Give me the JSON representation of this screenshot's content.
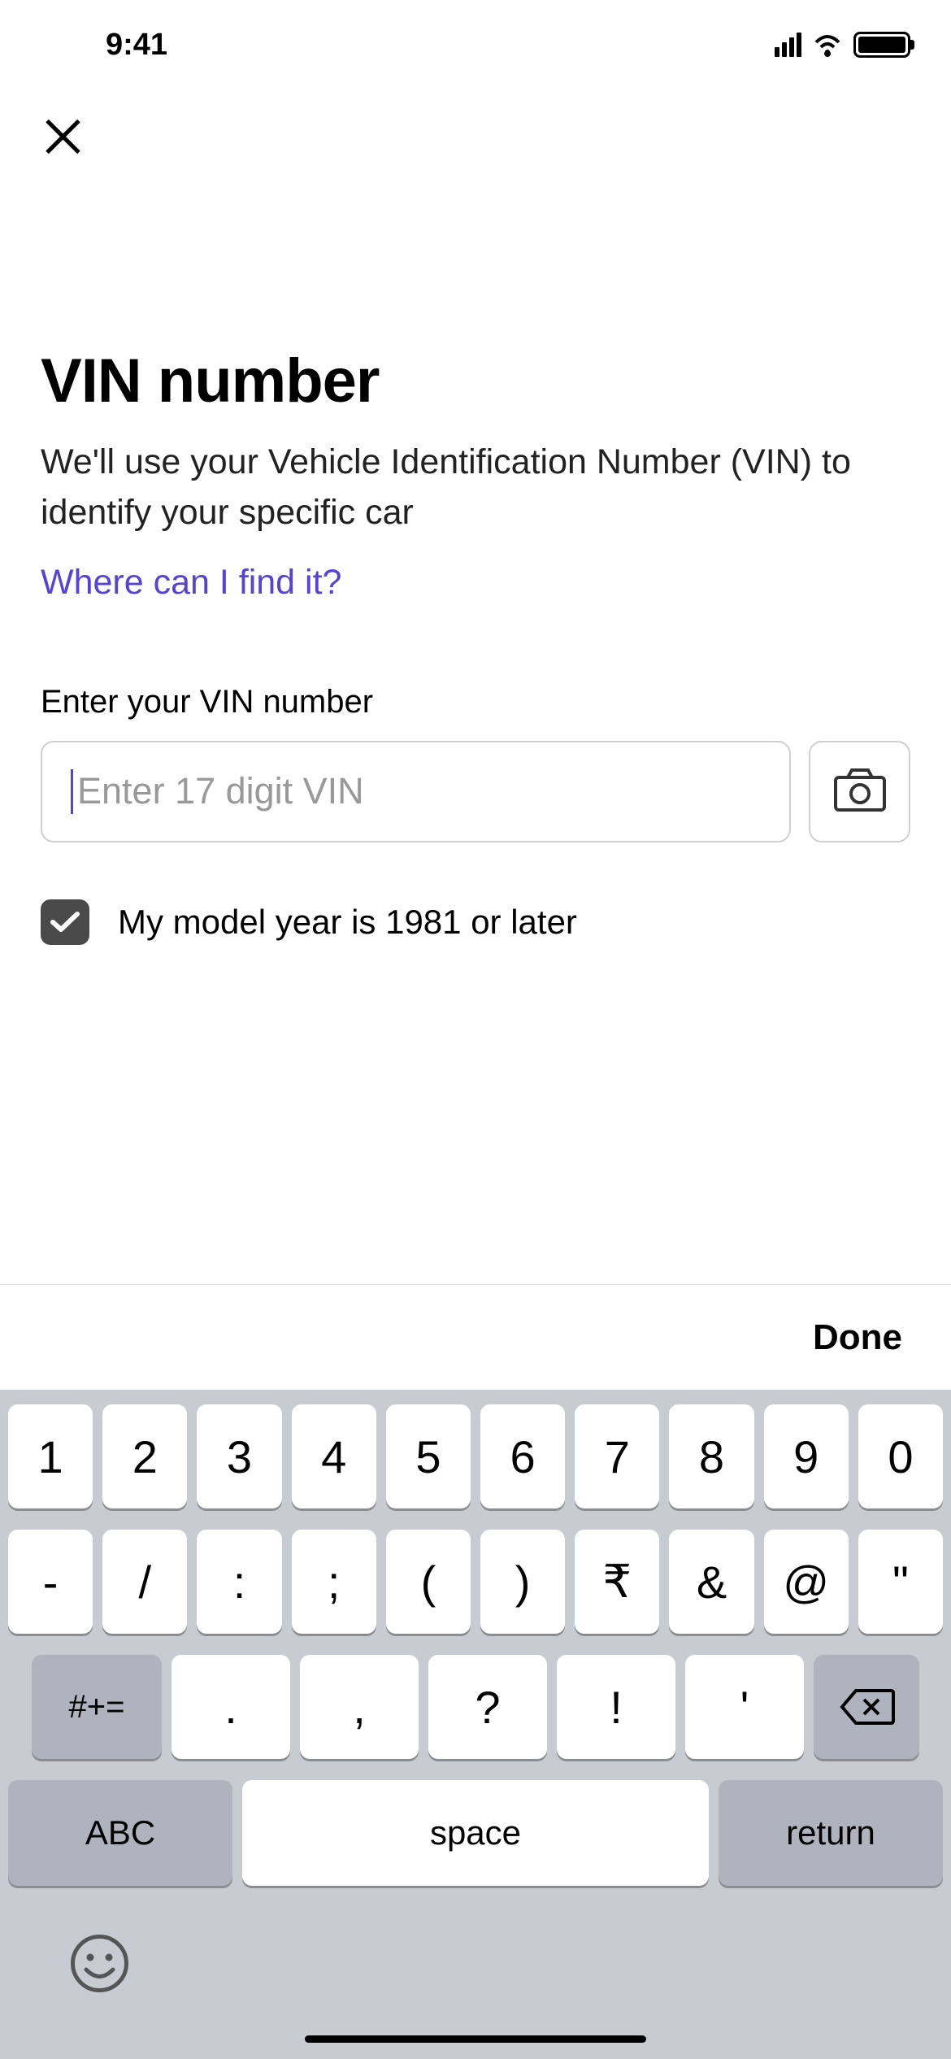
{
  "status_bar": {
    "time": "9:41"
  },
  "page": {
    "title": "VIN number",
    "description": "We'll use your Vehicle Identification Number (VIN) to identify your specific car",
    "help_link": "Where can I find it?",
    "field_label": "Enter your VIN number",
    "input_placeholder": "Enter 17 digit VIN",
    "checkbox_label": "My model year is 1981 or later",
    "checkbox_checked": true
  },
  "keyboard": {
    "toolbar_done": "Done",
    "row1": [
      "1",
      "2",
      "3",
      "4",
      "5",
      "6",
      "7",
      "8",
      "9",
      "0"
    ],
    "row2": [
      "-",
      "/",
      ":",
      ";",
      "(",
      ")",
      "₹",
      "&",
      "@",
      "\""
    ],
    "row3_symbols": "#+=",
    "row3": [
      ".",
      ",",
      "?",
      "!",
      "'"
    ],
    "row4_abc": "ABC",
    "row4_space": "space",
    "row4_return": "return"
  }
}
